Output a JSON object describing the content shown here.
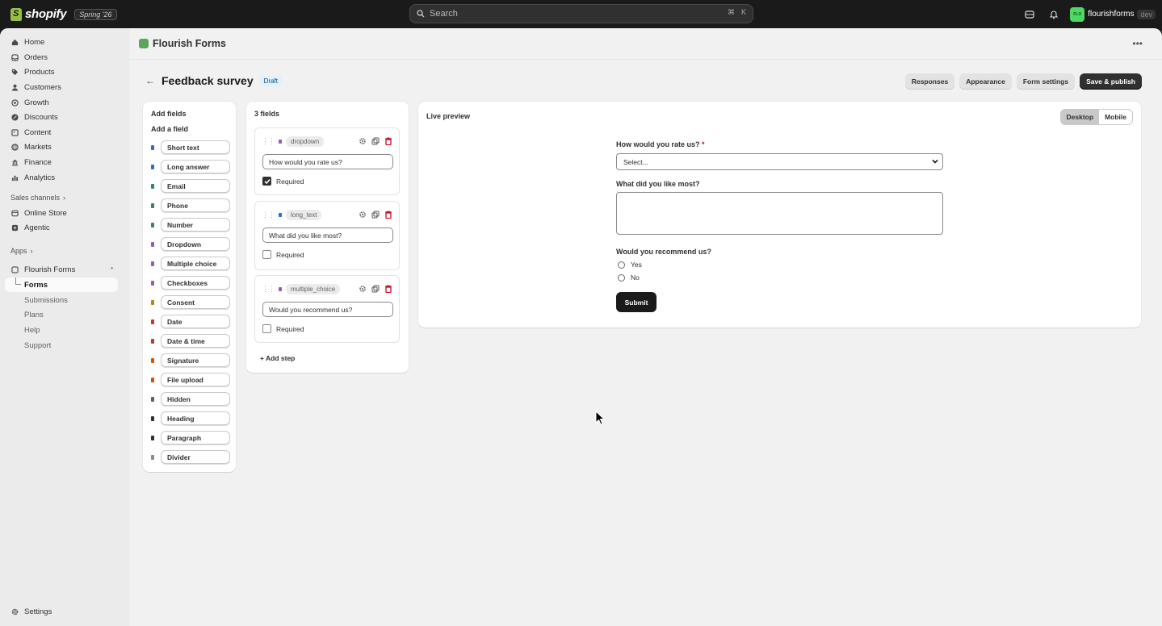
{
  "topbar": {
    "logo_text": "shopify",
    "edition_badge": "Spring '26",
    "search_placeholder": "Search",
    "search_shortcut_mod": "⌘",
    "search_shortcut_key": "K",
    "store_initials": "FLO",
    "store_name": "flourishforms",
    "store_env": "dev"
  },
  "sidebar": {
    "items": [
      {
        "label": "Home",
        "icon": "home-icon"
      },
      {
        "label": "Orders",
        "icon": "inbox-icon"
      },
      {
        "label": "Products",
        "icon": "tag-icon"
      },
      {
        "label": "Customers",
        "icon": "person-icon"
      },
      {
        "label": "Growth",
        "icon": "target-icon"
      },
      {
        "label": "Discounts",
        "icon": "discount-icon"
      },
      {
        "label": "Content",
        "icon": "content-icon"
      },
      {
        "label": "Markets",
        "icon": "globe-icon"
      },
      {
        "label": "Finance",
        "icon": "bank-icon"
      },
      {
        "label": "Analytics",
        "icon": "chart-icon"
      }
    ],
    "sales_channels_label": "Sales channels",
    "channels": [
      {
        "label": "Online Store",
        "icon": "store-icon"
      },
      {
        "label": "Agentic",
        "icon": "sparkle-icon"
      }
    ],
    "apps_label": "Apps",
    "app_name": "Flourish Forms",
    "app_sub": [
      "Forms",
      "Submissions",
      "Plans",
      "Help",
      "Support"
    ],
    "settings_label": "Settings"
  },
  "app_header": {
    "title": "Flourish Forms"
  },
  "page": {
    "title": "Feedback survey",
    "status": "Draft",
    "actions": {
      "responses": "Responses",
      "appearance": "Appearance",
      "form_settings": "Form settings",
      "publish": "Save & publish"
    }
  },
  "palette": {
    "title": "Add fields",
    "subtitle": "Add a field",
    "fields": [
      {
        "label": "Short text",
        "color": "#2c6ecb"
      },
      {
        "label": "Long answer",
        "color": "#2c6ecb"
      },
      {
        "label": "Email",
        "color": "#2e8b57"
      },
      {
        "label": "Phone",
        "color": "#2e8b57"
      },
      {
        "label": "Number",
        "color": "#2e8b57"
      },
      {
        "label": "Dropdown",
        "color": "#9b59b6"
      },
      {
        "label": "Multiple choice",
        "color": "#9b59b6"
      },
      {
        "label": "Checkboxes",
        "color": "#9b59b6"
      },
      {
        "label": "Consent",
        "color": "#b8860b"
      },
      {
        "label": "Date",
        "color": "#c0392b"
      },
      {
        "label": "Date & time",
        "color": "#c0392b"
      },
      {
        "label": "Signature",
        "color": "#d35400"
      },
      {
        "label": "File upload",
        "color": "#d35400"
      },
      {
        "label": "Hidden",
        "color": "#616161"
      },
      {
        "label": "Heading",
        "color": "#303030"
      },
      {
        "label": "Paragraph",
        "color": "#303030"
      },
      {
        "label": "Divider",
        "color": "#8a8a8a"
      }
    ]
  },
  "fields_list": {
    "count_label": "3 fields",
    "items": [
      {
        "type": "dropdown",
        "color": "#9b59b6",
        "label": "How would you rate us?",
        "required": true,
        "required_label": "Required"
      },
      {
        "type": "long_text",
        "color": "#2c6ecb",
        "label": "What did you like most?",
        "required": false,
        "required_label": "Required"
      },
      {
        "type": "multiple_choice",
        "color": "#9b59b6",
        "label": "Would you recommend us?",
        "required": false,
        "required_label": "Required"
      }
    ],
    "add_step": "+ Add step"
  },
  "preview": {
    "title": "Live preview",
    "desktop": "Desktop",
    "mobile": "Mobile",
    "q1": "How would you rate us?",
    "q1_required_mark": "*",
    "q1_select": "Select...",
    "q2": "What did you like most?",
    "q3": "Would you recommend us?",
    "q3_options": [
      "Yes",
      "No"
    ],
    "submit": "Submit"
  }
}
